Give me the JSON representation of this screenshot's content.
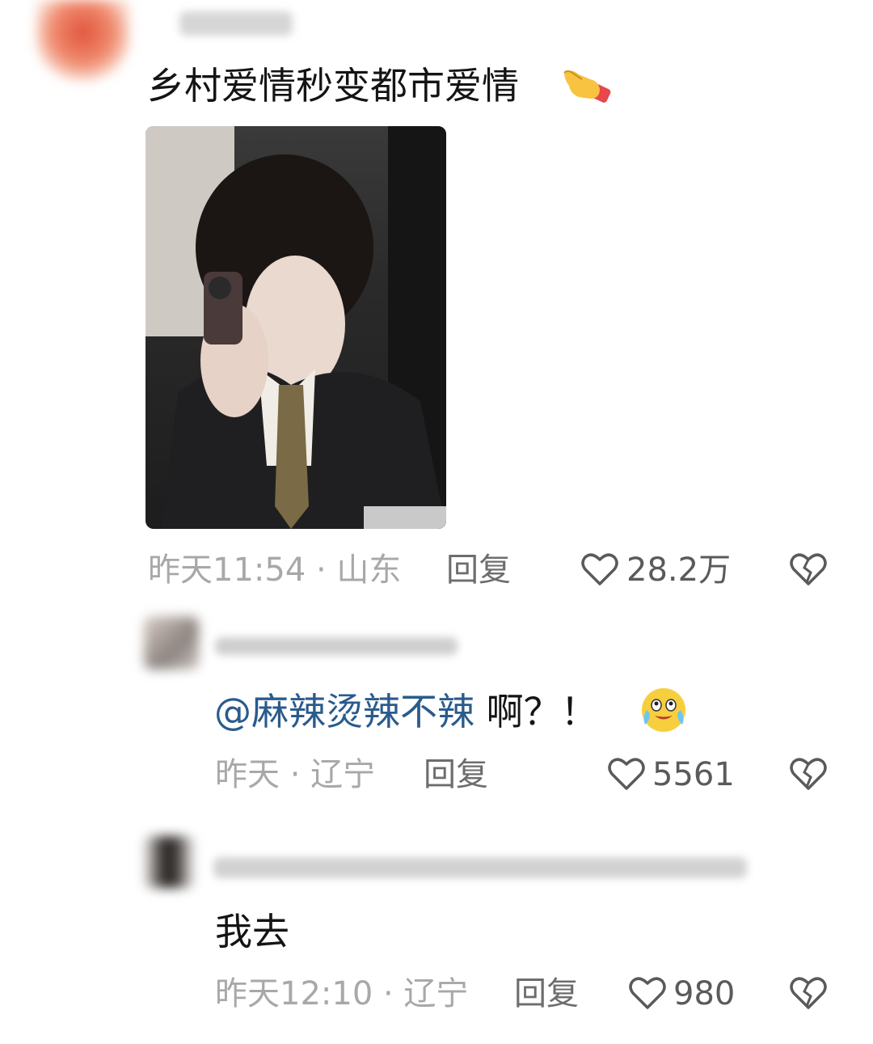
{
  "comments": [
    {
      "text": "乡村爱情秒变都市爱情",
      "emoji": "👉",
      "time": "昨天11:54 · 山东",
      "reply_label": "回复",
      "likes": "28.2万",
      "has_image": true
    },
    {
      "mention": "@麻辣烫辣不辣",
      "text": " 啊？！",
      "time": "昨天 · 辽宁",
      "reply_label": "回复",
      "likes": "5561"
    },
    {
      "text": "我去",
      "time": "昨天12:10 · 辽宁",
      "reply_label": "回复",
      "likes": "980"
    }
  ],
  "colors": {
    "mention": "#2a5b8c",
    "meta": "#a8a8a8"
  },
  "icons": [
    "heart-outline-icon",
    "broken-heart-icon",
    "crying-laughing-emoji-icon",
    "pointing-hand-emoji-icon"
  ]
}
